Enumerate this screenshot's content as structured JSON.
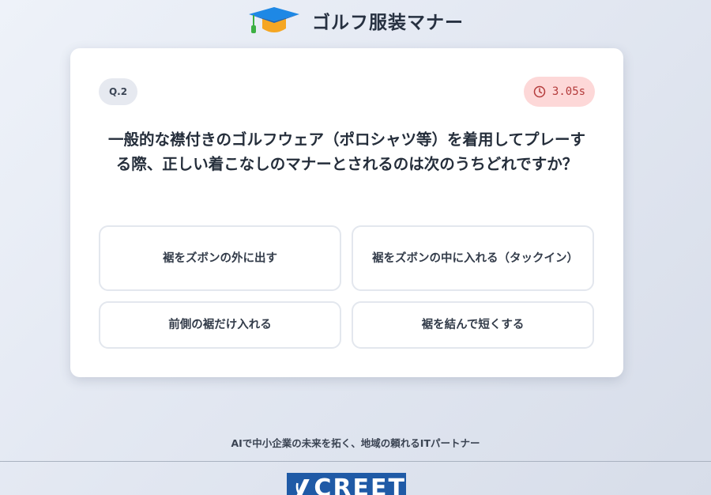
{
  "header": {
    "title": "ゴルフ服装マナー",
    "icon": "graduation-cap-icon"
  },
  "quiz": {
    "question_number": "Q.2",
    "timer": {
      "value": "3.05s",
      "icon": "clock-icon"
    },
    "question": "一般的な襟付きのゴルフウェア（ポロシャツ等）を着用してプレーする際、正しい着こなしのマナーとされるのは次のうちどれですか？",
    "options": [
      "裾をズボンの外に出す",
      "裾をズボンの中に入れる（タックイン）",
      "前側の裾だけ入れる",
      "裾を結んで短くする"
    ]
  },
  "footer": {
    "tagline": "AIで中小企業の未来を拓く、地域の頼れるITパートナー",
    "logo_text": "CREET"
  },
  "colors": {
    "accent_blue": "#1f5aa6",
    "timer_bg": "#fdd8d8",
    "timer_text": "#b43b3b",
    "cap_blue": "#1e88e5",
    "cap_orange": "#f5a623",
    "tassel_green": "#3cb043"
  }
}
